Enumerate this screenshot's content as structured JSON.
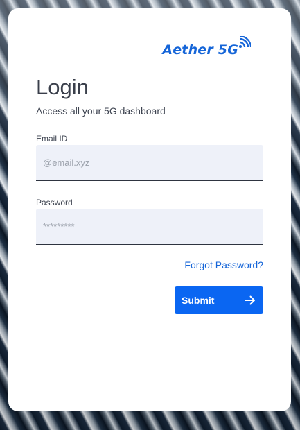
{
  "brand": {
    "name": "Aether 5G",
    "icon": "wifi-signal-icon",
    "color": "#1565d8"
  },
  "login": {
    "title": "Login",
    "subtitle": "Access all your 5G dashboard",
    "email": {
      "label": "Email ID",
      "placeholder": "@email.xyz",
      "value": ""
    },
    "password": {
      "label": "Password",
      "placeholder": "*********",
      "value": ""
    },
    "forgot_label": "Forgot Password?",
    "submit_label": "Submit",
    "submit_icon": "arrow-right-icon",
    "accent": "#0a66f2"
  }
}
